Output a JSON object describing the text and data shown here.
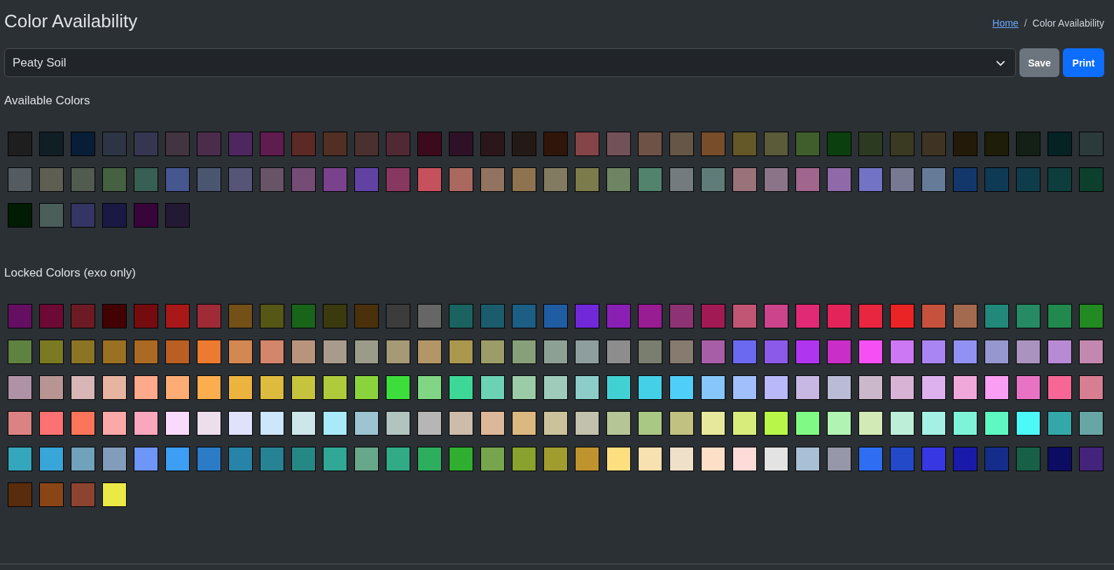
{
  "page_title": "Color Availability",
  "breadcrumb": {
    "separator": "/",
    "items": [
      {
        "label": "Home",
        "kind": "link"
      },
      {
        "label": "Color Availability",
        "kind": "current"
      }
    ]
  },
  "soil_select": {
    "value": "Peaty Soil"
  },
  "buttons": [
    {
      "label": "Save",
      "kind": "secondary"
    },
    {
      "label": "Print",
      "kind": "primary"
    }
  ],
  "available_section": {
    "heading": "Available Colors",
    "colors": [
      {
        "color": "#1e1e1e"
      },
      {
        "color": "#111e26"
      },
      {
        "color": "#081d36"
      },
      {
        "color": "#2d3544"
      },
      {
        "color": "#363650"
      },
      {
        "color": "#433441"
      },
      {
        "color": "#4b2c4a"
      },
      {
        "color": "#4f2760"
      },
      {
        "color": "#5f1c4e"
      },
      {
        "color": "#5c2925"
      },
      {
        "color": "#512f22"
      },
      {
        "color": "#4a3130"
      },
      {
        "color": "#512935"
      },
      {
        "color": "#3b0a1c"
      },
      {
        "color": "#2e1127"
      },
      {
        "color": "#2b171b"
      },
      {
        "color": "#231a16"
      },
      {
        "color": "#2f1608"
      },
      {
        "color": "#844448"
      },
      {
        "color": "#735158"
      },
      {
        "color": "#6f5246"
      },
      {
        "color": "#655645"
      },
      {
        "color": "#774d2a"
      },
      {
        "color": "#645728"
      },
      {
        "color": "#5b5a39"
      },
      {
        "color": "#405e2c"
      },
      {
        "color": "#0c3f10"
      },
      {
        "color": "#2c3a22"
      },
      {
        "color": "#3a3a22"
      },
      {
        "color": "#3f3322"
      },
      {
        "color": "#241a09"
      },
      {
        "color": "#1d1d08"
      },
      {
        "color": "#141f15"
      },
      {
        "color": "#052224"
      },
      {
        "color": "#2c3a3b"
      },
      {
        "color": "#545b61"
      },
      {
        "color": "#5e5e52"
      },
      {
        "color": "#515b4f"
      },
      {
        "color": "#466042"
      },
      {
        "color": "#385f53"
      },
      {
        "color": "#46568f"
      },
      {
        "color": "#4a5670"
      },
      {
        "color": "#565578"
      },
      {
        "color": "#675466"
      },
      {
        "color": "#744c74"
      },
      {
        "color": "#7a418c"
      },
      {
        "color": "#6142a3"
      },
      {
        "color": "#88385f"
      },
      {
        "color": "#c5515c"
      },
      {
        "color": "#a9695f"
      },
      {
        "color": "#92735f"
      },
      {
        "color": "#8f7350"
      },
      {
        "color": "#827b62"
      },
      {
        "color": "#7c7b4b"
      },
      {
        "color": "#6e8462"
      },
      {
        "color": "#51836d"
      },
      {
        "color": "#737b7f"
      },
      {
        "color": "#607c78"
      },
      {
        "color": "#9a727a"
      },
      {
        "color": "#8c7488"
      },
      {
        "color": "#a1668d"
      },
      {
        "color": "#906aa8"
      },
      {
        "color": "#7273c4"
      },
      {
        "color": "#777891"
      },
      {
        "color": "#667b98"
      },
      {
        "color": "#14376b"
      },
      {
        "color": "#0f3a55"
      },
      {
        "color": "#0f3c4b"
      },
      {
        "color": "#0d3d3c"
      },
      {
        "color": "#0c3f2c"
      },
      {
        "color": "#021b03"
      },
      {
        "color": "#4a5e5a"
      },
      {
        "color": "#353563"
      },
      {
        "color": "#191944"
      },
      {
        "color": "#37053a"
      },
      {
        "color": "#241932"
      }
    ]
  },
  "locked_section": {
    "heading": "Locked Colors (exo only)",
    "colors": [
      {
        "color": "#640f62"
      },
      {
        "color": "#6c0a35"
      },
      {
        "color": "#6c1b24"
      },
      {
        "color": "#420204"
      },
      {
        "color": "#740c0f"
      },
      {
        "color": "#a91818"
      },
      {
        "color": "#9e2b36"
      },
      {
        "color": "#735018"
      },
      {
        "color": "#565717"
      },
      {
        "color": "#186419"
      },
      {
        "color": "#3a3a0e"
      },
      {
        "color": "#4a310c"
      },
      {
        "color": "#3c3c3c"
      },
      {
        "color": "#666666"
      },
      {
        "color": "#1a6360"
      },
      {
        "color": "#1b5c6c"
      },
      {
        "color": "#1d5e84"
      },
      {
        "color": "#205ca2"
      },
      {
        "color": "#7028d8"
      },
      {
        "color": "#8a1fb4"
      },
      {
        "color": "#981d92"
      },
      {
        "color": "#8d3374"
      },
      {
        "color": "#a21a54"
      },
      {
        "color": "#c05674"
      },
      {
        "color": "#cc448b"
      },
      {
        "color": "#e02a75"
      },
      {
        "color": "#e3245a"
      },
      {
        "color": "#e82640"
      },
      {
        "color": "#ea2424"
      },
      {
        "color": "#c6523d"
      },
      {
        "color": "#a46a50"
      },
      {
        "color": "#22887a"
      },
      {
        "color": "#268a64"
      },
      {
        "color": "#22894e"
      },
      {
        "color": "#238923"
      },
      {
        "color": "#5f8241"
      },
      {
        "color": "#7b7a22"
      },
      {
        "color": "#8b7424"
      },
      {
        "color": "#9a7022"
      },
      {
        "color": "#ab6a23"
      },
      {
        "color": "#b95f23"
      },
      {
        "color": "#ed7a31"
      },
      {
        "color": "#d38751"
      },
      {
        "color": "#d4866b"
      },
      {
        "color": "#b8947d"
      },
      {
        "color": "#a99b8b"
      },
      {
        "color": "#9a9b88"
      },
      {
        "color": "#a59976"
      },
      {
        "color": "#b39668"
      },
      {
        "color": "#ab984f"
      },
      {
        "color": "#9c9c68"
      },
      {
        "color": "#87a07a"
      },
      {
        "color": "#8da094"
      },
      {
        "color": "#8e9e9e"
      },
      {
        "color": "#8d8d8d"
      },
      {
        "color": "#7a7e6e"
      },
      {
        "color": "#877b70"
      },
      {
        "color": "#a85ea6"
      },
      {
        "color": "#6a69f0"
      },
      {
        "color": "#8c5ae8"
      },
      {
        "color": "#b035ee"
      },
      {
        "color": "#c92ec8"
      },
      {
        "color": "#f650f5"
      },
      {
        "color": "#cc78f4"
      },
      {
        "color": "#a985f4"
      },
      {
        "color": "#9191f3"
      },
      {
        "color": "#9697cf"
      },
      {
        "color": "#aa94bf"
      },
      {
        "color": "#b98ad4"
      },
      {
        "color": "#c488b0"
      },
      {
        "color": "#b092a6"
      },
      {
        "color": "#b69593"
      },
      {
        "color": "#d8b6b6"
      },
      {
        "color": "#e6b4a0"
      },
      {
        "color": "#fca98c"
      },
      {
        "color": "#fdad73"
      },
      {
        "color": "#fcae4e"
      },
      {
        "color": "#ecb33e"
      },
      {
        "color": "#dcbb3e"
      },
      {
        "color": "#c6c43d"
      },
      {
        "color": "#aecb3b"
      },
      {
        "color": "#8ad33c"
      },
      {
        "color": "#3ddd3c"
      },
      {
        "color": "#80d684"
      },
      {
        "color": "#3dd897"
      },
      {
        "color": "#6bd2b3"
      },
      {
        "color": "#9ccca7"
      },
      {
        "color": "#9fcbbb"
      },
      {
        "color": "#8ccdca"
      },
      {
        "color": "#42d1d2"
      },
      {
        "color": "#44d0e6"
      },
      {
        "color": "#50cefa"
      },
      {
        "color": "#86c6fb"
      },
      {
        "color": "#a0bffb"
      },
      {
        "color": "#b8b8fb"
      },
      {
        "color": "#c6b8e2"
      },
      {
        "color": "#babbd6"
      },
      {
        "color": "#cbb9cb"
      },
      {
        "color": "#d8b3d5"
      },
      {
        "color": "#ddb1ee"
      },
      {
        "color": "#f0a8da"
      },
      {
        "color": "#f99ef3"
      },
      {
        "color": "#e873c4"
      },
      {
        "color": "#f66796"
      },
      {
        "color": "#d87e92"
      },
      {
        "color": "#db8383"
      },
      {
        "color": "#fc7273"
      },
      {
        "color": "#fc745a"
      },
      {
        "color": "#fba8a8"
      },
      {
        "color": "#faa6bd"
      },
      {
        "color": "#f9dafb"
      },
      {
        "color": "#eddeed"
      },
      {
        "color": "#e0e1fb"
      },
      {
        "color": "#cce6fb"
      },
      {
        "color": "#cde6ea"
      },
      {
        "color": "#a8eafa"
      },
      {
        "color": "#9cc5d1"
      },
      {
        "color": "#b1c4c0"
      },
      {
        "color": "#b6b6b6"
      },
      {
        "color": "#cdbcaa"
      },
      {
        "color": "#dcb798"
      },
      {
        "color": "#dcb881"
      },
      {
        "color": "#cbc29b"
      },
      {
        "color": "#c1c1ad"
      },
      {
        "color": "#b6c596"
      },
      {
        "color": "#a8c884"
      },
      {
        "color": "#c1c282"
      },
      {
        "color": "#e8e89d"
      },
      {
        "color": "#d8ec7b"
      },
      {
        "color": "#b8f64a"
      },
      {
        "color": "#80fa84"
      },
      {
        "color": "#b0f3b3"
      },
      {
        "color": "#d2eab5"
      },
      {
        "color": "#bdeed8"
      },
      {
        "color": "#a4f0e4"
      },
      {
        "color": "#7df4d8"
      },
      {
        "color": "#5ef8c3"
      },
      {
        "color": "#4df8f8"
      },
      {
        "color": "#34a8a8"
      },
      {
        "color": "#68a5a5"
      },
      {
        "color": "#35a7bc"
      },
      {
        "color": "#38a6d8"
      },
      {
        "color": "#70a2bb"
      },
      {
        "color": "#829cbb"
      },
      {
        "color": "#6d96f8"
      },
      {
        "color": "#3c9ef4"
      },
      {
        "color": "#2b7bc7"
      },
      {
        "color": "#2783a8"
      },
      {
        "color": "#268393"
      },
      {
        "color": "#268884"
      },
      {
        "color": "#31a796"
      },
      {
        "color": "#67a78a"
      },
      {
        "color": "#30ab85"
      },
      {
        "color": "#2dae5e"
      },
      {
        "color": "#30ae2f"
      },
      {
        "color": "#77a54d"
      },
      {
        "color": "#88a22d"
      },
      {
        "color": "#a09d2e"
      },
      {
        "color": "#bf942f"
      },
      {
        "color": "#fddf80"
      },
      {
        "color": "#f8e1b0"
      },
      {
        "color": "#efe1c9"
      },
      {
        "color": "#fcdfc6"
      },
      {
        "color": "#fcdbd9"
      },
      {
        "color": "#e3e3e3"
      },
      {
        "color": "#a9bfd6"
      },
      {
        "color": "#9697a8"
      },
      {
        "color": "#2f6ef2"
      },
      {
        "color": "#2349c9"
      },
      {
        "color": "#3837e4"
      },
      {
        "color": "#1a1aaa"
      },
      {
        "color": "#142d8a"
      },
      {
        "color": "#176047"
      },
      {
        "color": "#0c0c62"
      },
      {
        "color": "#43237c"
      },
      {
        "color": "#592c0d"
      },
      {
        "color": "#8a4517"
      },
      {
        "color": "#8c4430"
      },
      {
        "color": "#ebe945"
      }
    ]
  }
}
